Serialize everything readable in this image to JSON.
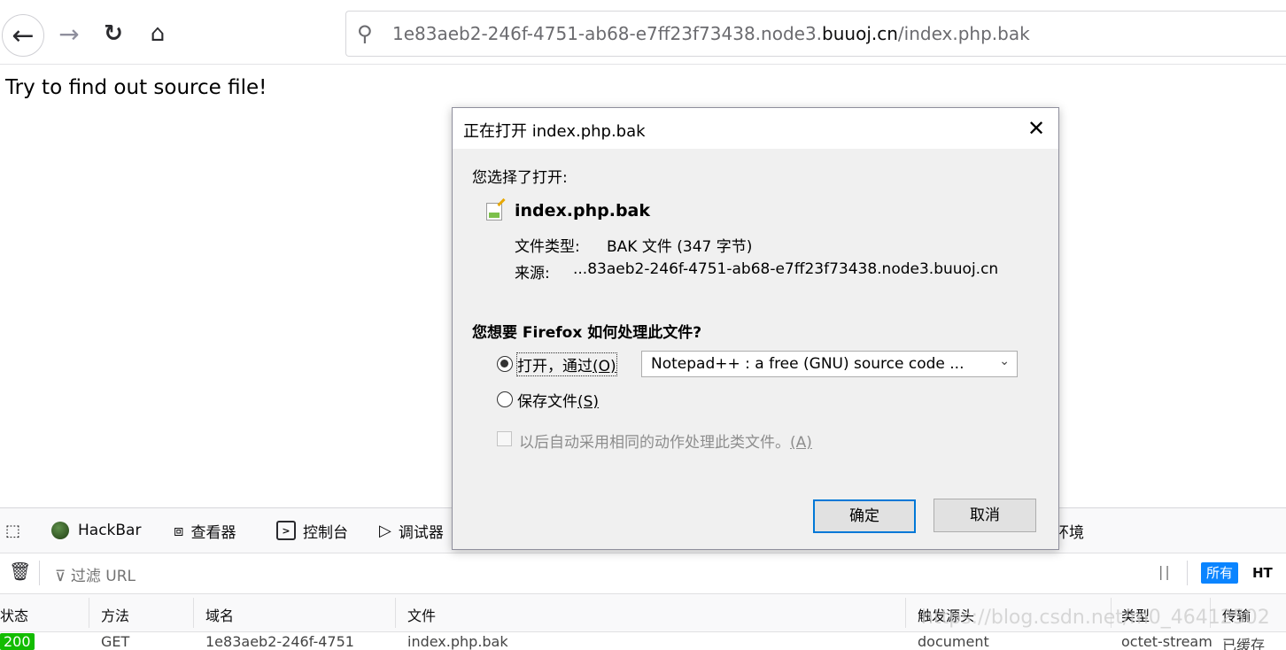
{
  "browser": {
    "url_prefix": "1e83aeb2-246f-4751-ab68-e7ff23f73438.node3.",
    "url_host": "buuoj.cn",
    "url_path": "/index.php.bak"
  },
  "page": {
    "message": "Try to find out source file!"
  },
  "dialog": {
    "title": "正在打开 index.php.bak",
    "you_chose": "您选择了打开:",
    "filename": "index.php.bak",
    "file_type_label": "文件类型:",
    "file_type_value": "BAK 文件 (347 字节)",
    "source_label": "来源:",
    "source_value": "...83aeb2-246f-4751-ab68-e7ff23f73438.node3.buuoj.cn",
    "question": "您想要 Firefox 如何处理此文件?",
    "open_with_label": "打开，通过",
    "open_with_key": "(O)",
    "open_with_app": "Notepad++ : a free (GNU) source code ...",
    "save_label": "保存文件",
    "save_key": "(S)",
    "auto_label": "以后自动采用相同的动作处理此类文件。",
    "auto_key": "(A)",
    "ok_label": "确定",
    "cancel_label": "取消"
  },
  "devtools": {
    "tabs": {
      "hackbar": "HackBar",
      "inspector": "查看器",
      "console": "控制台",
      "debugger": "调试器",
      "storage_suffix": "环境"
    },
    "filter_placeholder": "过滤 URL",
    "pause_glyph": "||",
    "all_chip": "所有",
    "html_chip": "HT",
    "columns": {
      "status": "状态",
      "method": "方法",
      "domain": "域名",
      "file": "文件",
      "cause": "触发源头",
      "type": "类型",
      "transferred": "传输"
    },
    "row": {
      "status": "200",
      "method": "GET",
      "domain": "1e83aeb2-246f-4751",
      "file": "index.php.bak",
      "cause": "document",
      "type": "octet-stream",
      "transferred": "已缓存"
    }
  },
  "watermark": "https://blog.csdn.net/m0_46412502",
  "icons": {
    "back": "back-arrow-icon",
    "forward": "forward-arrow-icon",
    "reload": "reload-icon",
    "home": "home-icon",
    "search": "search-icon",
    "close": "close-icon",
    "trash": "trash-icon",
    "filter": "filter-icon"
  },
  "colors": {
    "accent": "#0a84ff",
    "dialog_ok_border": "#0078d7",
    "status_ok": "#12bc00"
  }
}
